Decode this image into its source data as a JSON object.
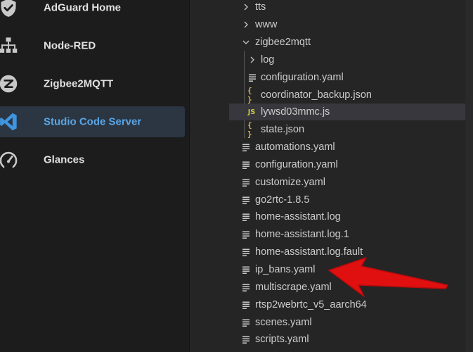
{
  "sidebar": {
    "items": [
      {
        "label": "AdGuard Home",
        "icon": "shield-check-icon"
      },
      {
        "label": "Node-RED",
        "icon": "sitemap-icon"
      },
      {
        "label": "Zigbee2MQTT",
        "icon": "zigbee-icon"
      },
      {
        "label": "Studio Code Server",
        "icon": "vscode-icon",
        "active": true
      },
      {
        "label": "Glances",
        "icon": "gauge-icon"
      }
    ]
  },
  "explorer": {
    "rows": [
      {
        "name": "tts",
        "kind": "folder-collapsed"
      },
      {
        "name": "www",
        "kind": "folder-collapsed"
      },
      {
        "name": "zigbee2mqtt",
        "kind": "folder-expanded"
      },
      {
        "name": "log",
        "kind": "folder-collapsed"
      },
      {
        "name": "configuration.yaml",
        "kind": "file"
      },
      {
        "name": "coordinator_backup.json",
        "kind": "json"
      },
      {
        "name": "lywsd03mmc.js",
        "kind": "js",
        "icon_text": "JS",
        "selected": true
      },
      {
        "name": "state.json",
        "kind": "json"
      },
      {
        "name": "automations.yaml",
        "kind": "file"
      },
      {
        "name": "configuration.yaml",
        "kind": "file"
      },
      {
        "name": "customize.yaml",
        "kind": "file"
      },
      {
        "name": "go2rtc-1.8.5",
        "kind": "file"
      },
      {
        "name": "home-assistant.log",
        "kind": "file"
      },
      {
        "name": "home-assistant.log.1",
        "kind": "file"
      },
      {
        "name": "home-assistant.log.fault",
        "kind": "file"
      },
      {
        "name": "ip_bans.yaml",
        "kind": "file"
      },
      {
        "name": "multiscrape.yaml",
        "kind": "file"
      },
      {
        "name": "rtsp2webrtc_v5_aarch64",
        "kind": "file"
      },
      {
        "name": "scenes.yaml",
        "kind": "file"
      },
      {
        "name": "scripts.yaml",
        "kind": "file"
      }
    ]
  },
  "annotation": {
    "color": "#e01010",
    "points_to": "ip_bans.yaml"
  }
}
